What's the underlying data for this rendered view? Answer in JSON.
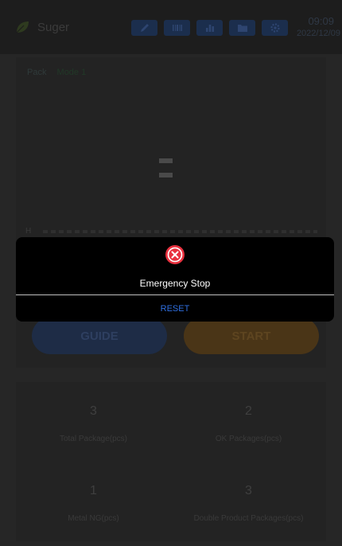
{
  "header": {
    "app_name": "Suger",
    "time": "09:09",
    "date": "2022/12/09",
    "toolbar": [
      "pencil-icon",
      "barcode-icon",
      "bar-chart-icon",
      "folder-icon",
      "gear-icon"
    ]
  },
  "main": {
    "mode_pack": "Pack",
    "mode_name": "Mode 1",
    "h_label": "H",
    "guide_label": "GUIDE",
    "start_label": "START"
  },
  "stats": [
    {
      "value": "3",
      "label": "Total Package(pcs)"
    },
    {
      "value": "2",
      "label": "OK Packages(pcs)"
    },
    {
      "value": "1",
      "label": "Metal NG(pcs)"
    },
    {
      "value": "3",
      "label": "Double Product Packages(pcs)"
    }
  ],
  "modal": {
    "message": "Emergency Stop",
    "reset_label": "RESET"
  },
  "colors": {
    "accent_blue": "#2f6fe0",
    "error_red": "#e8313f",
    "start_orange": "#5e4520"
  }
}
